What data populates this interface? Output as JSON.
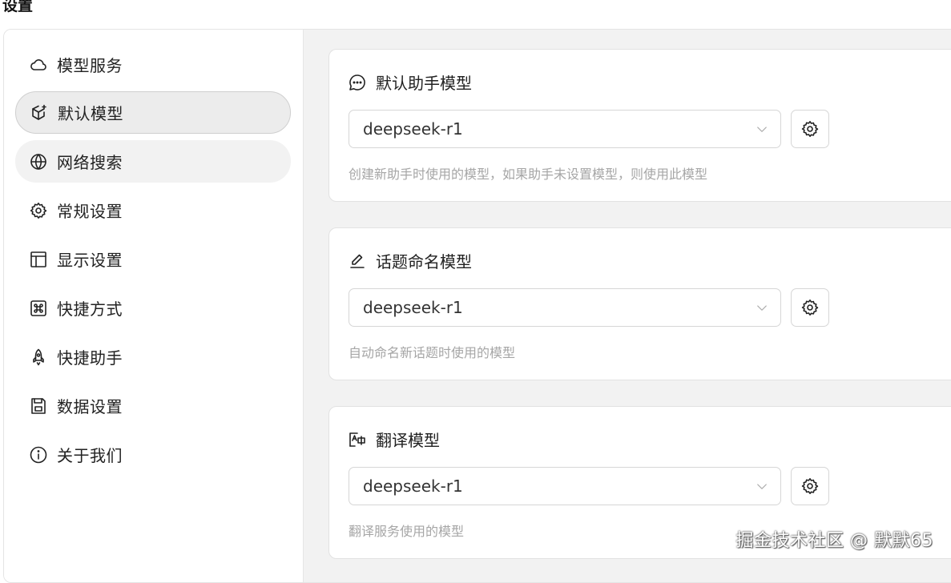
{
  "page": {
    "title": "设置"
  },
  "sidebar": {
    "items": [
      {
        "label": "模型服务",
        "icon": "cloud-icon"
      },
      {
        "label": "默认模型",
        "icon": "cube-sparkle-icon",
        "state": "active"
      },
      {
        "label": "网络搜索",
        "icon": "globe-icon",
        "state": "hover"
      },
      {
        "label": "常规设置",
        "icon": "gear-icon"
      },
      {
        "label": "显示设置",
        "icon": "layout-panel-icon"
      },
      {
        "label": "快捷方式",
        "icon": "command-key-icon"
      },
      {
        "label": "快捷助手",
        "icon": "rocket-icon"
      },
      {
        "label": "数据设置",
        "icon": "floppy-disk-icon"
      },
      {
        "label": "关于我们",
        "icon": "info-circle-icon"
      }
    ]
  },
  "cards": [
    {
      "title": "默认助手模型",
      "icon": "chat-bubble-dots-icon",
      "select_value": "deepseek-r1",
      "description": "创建新助手时使用的模型，如果助手未设置模型，则使用此模型"
    },
    {
      "title": "话题命名模型",
      "icon": "pen-underline-icon",
      "select_value": "deepseek-r1",
      "description": "自动命名新话题时使用的模型"
    },
    {
      "title": "翻译模型",
      "icon": "translate-icon",
      "select_value": "deepseek-r1",
      "description": "翻译服务使用的模型"
    }
  ],
  "watermark": "掘金技术社区 @ 默默65"
}
